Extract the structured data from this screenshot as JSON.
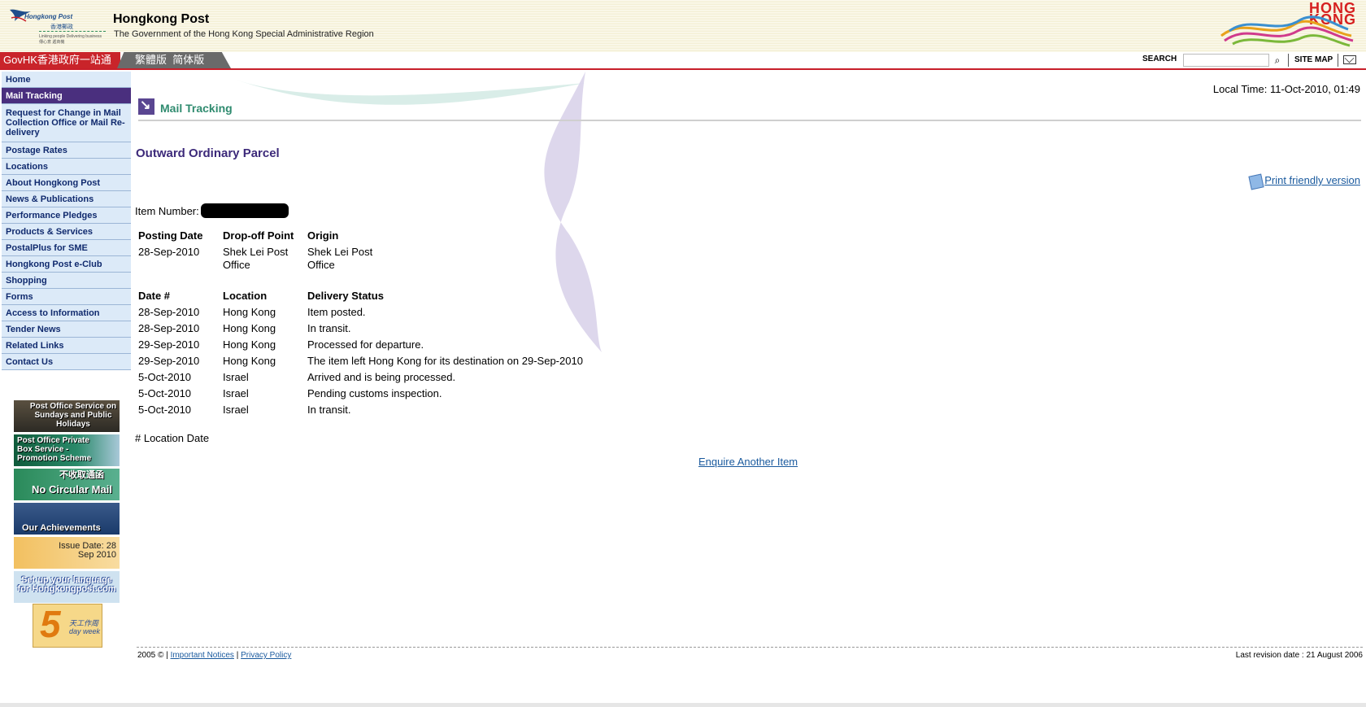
{
  "header": {
    "logo_en": "Hongkong Post",
    "logo_zh": "香港郵政",
    "logo_tagline": "Linking people Delivering business",
    "logo_tagline_zh": "傳心意 遞商機",
    "title": "Hongkong Post",
    "subtitle": "The Government of the Hong Kong Special Administrative Region",
    "brand_line1": "HONG",
    "brand_line2": "KONG"
  },
  "topbar": {
    "govhk": "GovHK香港政府一站通",
    "lang_trad": "繁體版",
    "lang_simp": "简体版",
    "search_label": "SEARCH",
    "search_value": "",
    "sitemap": "SITE MAP"
  },
  "sidebar": {
    "items": [
      {
        "label": "Home"
      },
      {
        "label": "Mail Tracking"
      },
      {
        "label": "Request for Change in Mail Collection Office or Mail Re-delivery"
      },
      {
        "label": "Postage Rates"
      },
      {
        "label": "Locations"
      },
      {
        "label": "About Hongkong Post"
      },
      {
        "label": "News & Publications"
      },
      {
        "label": "Performance Pledges"
      },
      {
        "label": "Products & Services"
      },
      {
        "label": "PostalPlus for SME"
      },
      {
        "label": "Hongkong Post e-Club"
      },
      {
        "label": "Shopping"
      },
      {
        "label": "Forms"
      },
      {
        "label": "Access to Information"
      },
      {
        "label": "Tender News"
      },
      {
        "label": "Related Links"
      },
      {
        "label": "Contact Us"
      }
    ],
    "banners": [
      {
        "text": "Post Office Service on Sundays and Public Holidays"
      },
      {
        "text": "Post Office Private Box Service - Promotion Scheme"
      },
      {
        "text_zh": "不收取通函",
        "text": "No Circular Mail"
      },
      {
        "text": "Our Achievements"
      },
      {
        "text": "Issue Date: 28 Sep 2010"
      },
      {
        "text": "Set up your language for Hongkongpost.com"
      }
    ],
    "five_day": {
      "num": "5",
      "zh": "天工作周",
      "en": "day week"
    }
  },
  "main": {
    "local_time": "Local Time: 11-Oct-2010, 01:49",
    "section": "Mail Tracking",
    "page_title": "Outward Ordinary Parcel",
    "print_link": "Print friendly version",
    "item_number_label": "Item Number:",
    "posting": {
      "headers": [
        "Posting Date",
        "Drop-off Point",
        "Origin"
      ],
      "row": [
        "28-Sep-2010",
        "Shek Lei Post Office",
        "Shek Lei Post Office"
      ]
    },
    "events": {
      "headers": [
        "Date #",
        "Location",
        "Delivery Status"
      ],
      "rows": [
        [
          "28-Sep-2010",
          "Hong Kong",
          "Item posted."
        ],
        [
          "28-Sep-2010",
          "Hong Kong",
          "In transit."
        ],
        [
          "29-Sep-2010",
          "Hong Kong",
          "Processed for departure."
        ],
        [
          "29-Sep-2010",
          "Hong Kong",
          "The item left Hong Kong for its destination on 29-Sep-2010"
        ],
        [
          "5-Oct-2010",
          "Israel",
          "Arrived and is being processed."
        ],
        [
          "5-Oct-2010",
          "Israel",
          "Pending customs inspection."
        ],
        [
          "5-Oct-2010",
          "Israel",
          "In transit."
        ]
      ]
    },
    "location_note": "# Location Date",
    "enquire_link": "Enquire Another Item"
  },
  "footer": {
    "copyright": "2005 © |",
    "important_notices": "Important Notices",
    "sep": "|",
    "privacy": "Privacy Policy",
    "revision": "Last revision date : 21 August 2006"
  }
}
